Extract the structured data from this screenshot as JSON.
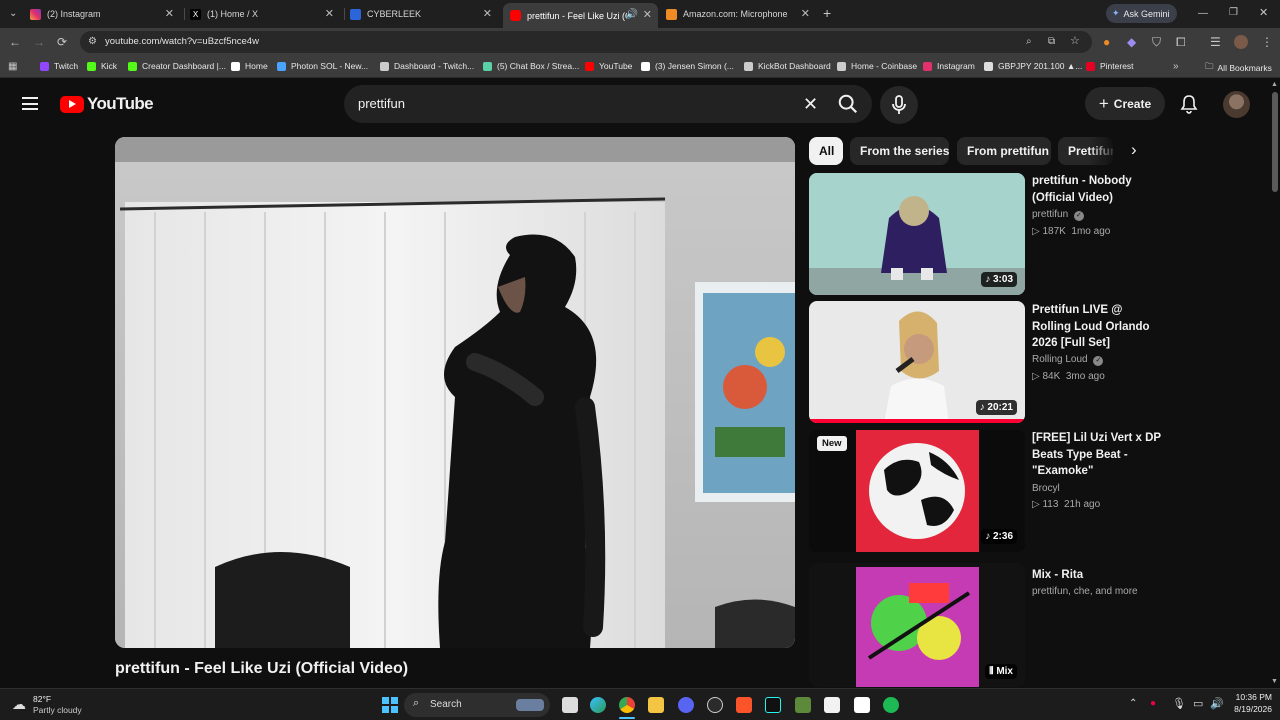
{
  "browser": {
    "tabs": [
      {
        "title": "(2) Instagram",
        "favicon": "instagram-icon",
        "active": false
      },
      {
        "title": "(1) Home / X",
        "favicon": "x-icon",
        "active": false
      },
      {
        "title": "CYBERLEEK",
        "favicon": "cyberleek-icon",
        "active": false
      },
      {
        "title": "prettifun - Feel Like Uzi (Offi",
        "favicon": "youtube-icon",
        "active": true
      },
      {
        "title": "Amazon.com: Microphone",
        "favicon": "amazon-icon",
        "active": false
      }
    ],
    "ask_gemini": "Ask Gemini",
    "url": "youtube.com/watch?v=uBzcf5nce4w",
    "bookmarks": [
      {
        "label": "Twitch",
        "color": "#9146ff"
      },
      {
        "label": "Kick",
        "color": "#53fc18"
      },
      {
        "label": "Creator Dashboard |...",
        "color": "#53fc18"
      },
      {
        "label": "Home",
        "color": "#ffffff"
      },
      {
        "label": "Photon SOL - New...",
        "color": "#4aa3ff"
      },
      {
        "label": "Dashboard - Twitch...",
        "color": "#cccccc"
      },
      {
        "label": "(5) Chat Box / Strea...",
        "color": "#5ad1a6"
      },
      {
        "label": "YouTube",
        "color": "#ff0000"
      },
      {
        "label": "(3) Jensen Simon (...",
        "color": "#ffffff"
      },
      {
        "label": "KickBot Dashboard",
        "color": "#cccccc"
      },
      {
        "label": "Home - Coinbase",
        "color": "#cccccc"
      },
      {
        "label": "Instagram",
        "color": "#e1306c"
      },
      {
        "label": "GBPJPY 201.100 ▲...",
        "color": "#dddddd"
      },
      {
        "label": "Pinterest",
        "color": "#e60023"
      }
    ],
    "all_bookmarks": "All Bookmarks"
  },
  "youtube": {
    "logo_text": "YouTube",
    "search_query": "prettifun",
    "create_label": "Create",
    "video_title": "prettifun - Feel Like Uzi (Official Video)",
    "chips": [
      "All",
      "From the series",
      "From prettifun",
      "Prettifun"
    ],
    "recommendations": [
      {
        "title": "prettifun - Nobody (Official Video)",
        "channel": "prettifun",
        "views": "187K",
        "age": "1mo ago",
        "duration": "3:03",
        "verified": true
      },
      {
        "title": "Prettifun LIVE @ Rolling Loud Orlando 2026 [Full Set]",
        "channel": "Rolling Loud",
        "views": "84K",
        "age": "3mo ago",
        "duration": "20:21",
        "verified": true,
        "progress": 1.0
      },
      {
        "title": "[FREE] Lil Uzi Vert x DP Beats Type Beat - \"Examoke\"",
        "channel": "Brocyl",
        "views": "113",
        "age": "21h ago",
        "duration": "2:36",
        "badge": "New"
      },
      {
        "title": "Mix - Rita",
        "channel": "prettifun, che, and more",
        "duration": "Mix"
      }
    ]
  },
  "taskbar": {
    "weather_temp": "82°F",
    "weather_text": "Partly cloudy",
    "search_label": "Search",
    "time": "10:36 PM",
    "date": "8/19/2026"
  }
}
